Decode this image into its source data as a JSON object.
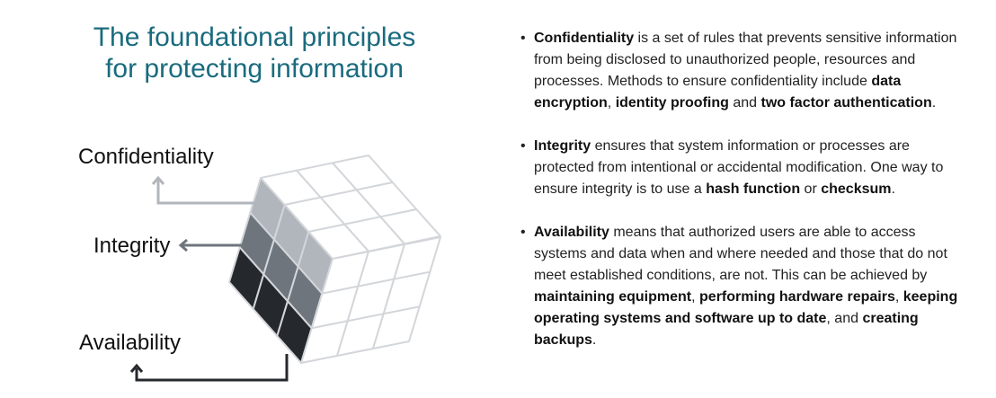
{
  "title": {
    "line1": "The foundational principles",
    "line2": "for protecting information"
  },
  "diagram": {
    "labels": {
      "confidentiality": "Confidentiality",
      "integrity": "Integrity",
      "availability": "Availability"
    },
    "colors": {
      "confidentiality": "#b1b6bc",
      "integrity": "#6f757d",
      "availability": "#25282c",
      "grid": "#d3d6da",
      "title": "#1a6b7e"
    }
  },
  "bullets": [
    {
      "segments": [
        {
          "t": "Confidentiality",
          "b": true
        },
        {
          "t": " is a set of rules that prevents sensitive information from being disclosed to unauthorized people, resources and processes. Methods to ensure confidentiality include ",
          "b": false
        },
        {
          "t": "data encryption",
          "b": true
        },
        {
          "t": ", ",
          "b": false
        },
        {
          "t": "identity proofing",
          "b": true
        },
        {
          "t": " and ",
          "b": false
        },
        {
          "t": "two factor authentication",
          "b": true
        },
        {
          "t": ".",
          "b": false
        }
      ]
    },
    {
      "segments": [
        {
          "t": "Integrity",
          "b": true
        },
        {
          "t": " ensures that system information or processes are protected from intentional or accidental modification. One way to ensure integrity is to use a ",
          "b": false
        },
        {
          "t": "hash function",
          "b": true
        },
        {
          "t": " or ",
          "b": false
        },
        {
          "t": "checksum",
          "b": true
        },
        {
          "t": ".",
          "b": false
        }
      ]
    },
    {
      "segments": [
        {
          "t": "Availability",
          "b": true
        },
        {
          "t": " means that authorized users are able to access systems and data when and where needed and those that do not meet established conditions, are not. This can be achieved by ",
          "b": false
        },
        {
          "t": "maintaining equipment",
          "b": true
        },
        {
          "t": ", ",
          "b": false
        },
        {
          "t": "performing hardware repairs",
          "b": true
        },
        {
          "t": ", ",
          "b": false
        },
        {
          "t": "keeping operating systems and software up to date",
          "b": true
        },
        {
          "t": ", and ",
          "b": false
        },
        {
          "t": "creating backups",
          "b": true
        },
        {
          "t": ".",
          "b": false
        }
      ]
    }
  ]
}
